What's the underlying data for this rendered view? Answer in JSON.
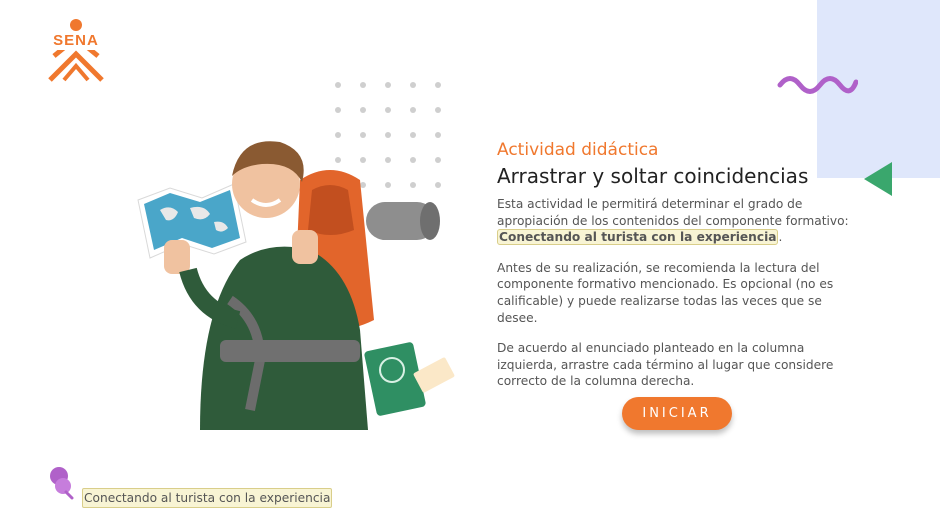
{
  "brand": {
    "logo_text": "SENA",
    "accent_color": "#f0782e",
    "purple": "#b061c9",
    "green": "#3aa76d"
  },
  "activity": {
    "subtitle": "Actividad didáctica",
    "title": "Arrastrar y soltar coincidencias",
    "para1_a": "Esta actividad le permitirá determinar el grado de apropiación de los contenidos del componente formativo: ",
    "para1_highlight": "Conectando al turista con la experiencia",
    "para1_b": ".",
    "para2": "Antes de su realización, se recomienda la lectura del componente formativo mencionado.  Es opcional (no es calificable) y puede realizarse todas las veces que se desee.",
    "para3": "De acuerdo al enunciado planteado en la columna izquierda, arrastre cada término al lugar que considere correcto de la columna derecha."
  },
  "start_button": {
    "label": "INICIAR"
  },
  "footer": {
    "label": "Conectando al turista con la experiencia",
    "icon": "pin-icon"
  },
  "hero": {
    "icon": "traveler-illustration"
  }
}
